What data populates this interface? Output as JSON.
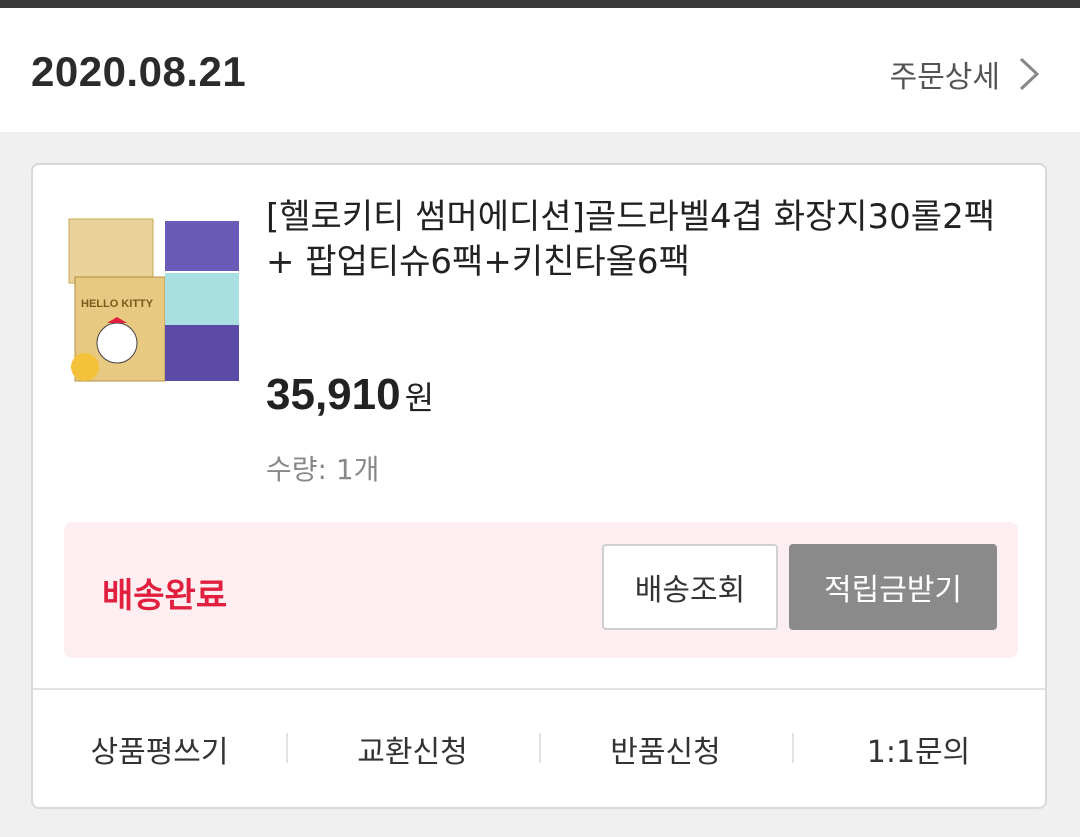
{
  "order": {
    "date": "2020.08.21",
    "detail_label": "주문상세"
  },
  "product": {
    "title": "[헬로키티 썸머에디션]골드라벨4겹 화장지30롤2팩+ 팝업티슈6팩+키친타올6팩",
    "price": "35,910",
    "currency": "원",
    "quantity": "수량: 1개",
    "thumbnail_text": "HELLO KITTY"
  },
  "status": {
    "label": "배송완료",
    "track_button": "배송조회",
    "points_button": "적립금받기"
  },
  "actions": [
    {
      "label": "상품평쓰기"
    },
    {
      "label": "교환신청"
    },
    {
      "label": "반품신청"
    },
    {
      "label": "1:1문의"
    }
  ],
  "colors": {
    "status_red": "#e0203e",
    "status_bg": "#fdeff1",
    "points_button_bg": "#8a8a8a"
  }
}
